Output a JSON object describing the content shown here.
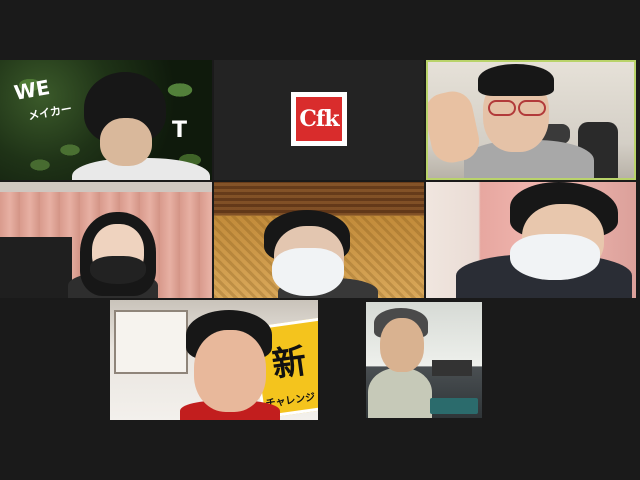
{
  "meeting": {
    "view": "gallery",
    "participant_count": 8,
    "active_speaker_color": "#b9d36a",
    "background_color": "#1a1a1a"
  },
  "tiles": [
    {
      "position": "row1-col1",
      "sign_left": "WE",
      "sign_sub": "メイカー",
      "sign_right": "T"
    },
    {
      "position": "row1-col2",
      "logo_text": "Cfk",
      "logo_color": "#d92c2c"
    },
    {
      "position": "row1-col3",
      "active_speaker": true
    },
    {
      "position": "row2-col1"
    },
    {
      "position": "row2-col2"
    },
    {
      "position": "row2-col3"
    },
    {
      "position": "row3-col1",
      "sign_text": "新",
      "sign_sub": "チャレンジ",
      "sign_color": "#f4c41d"
    },
    {
      "position": "row3-col2"
    }
  ]
}
